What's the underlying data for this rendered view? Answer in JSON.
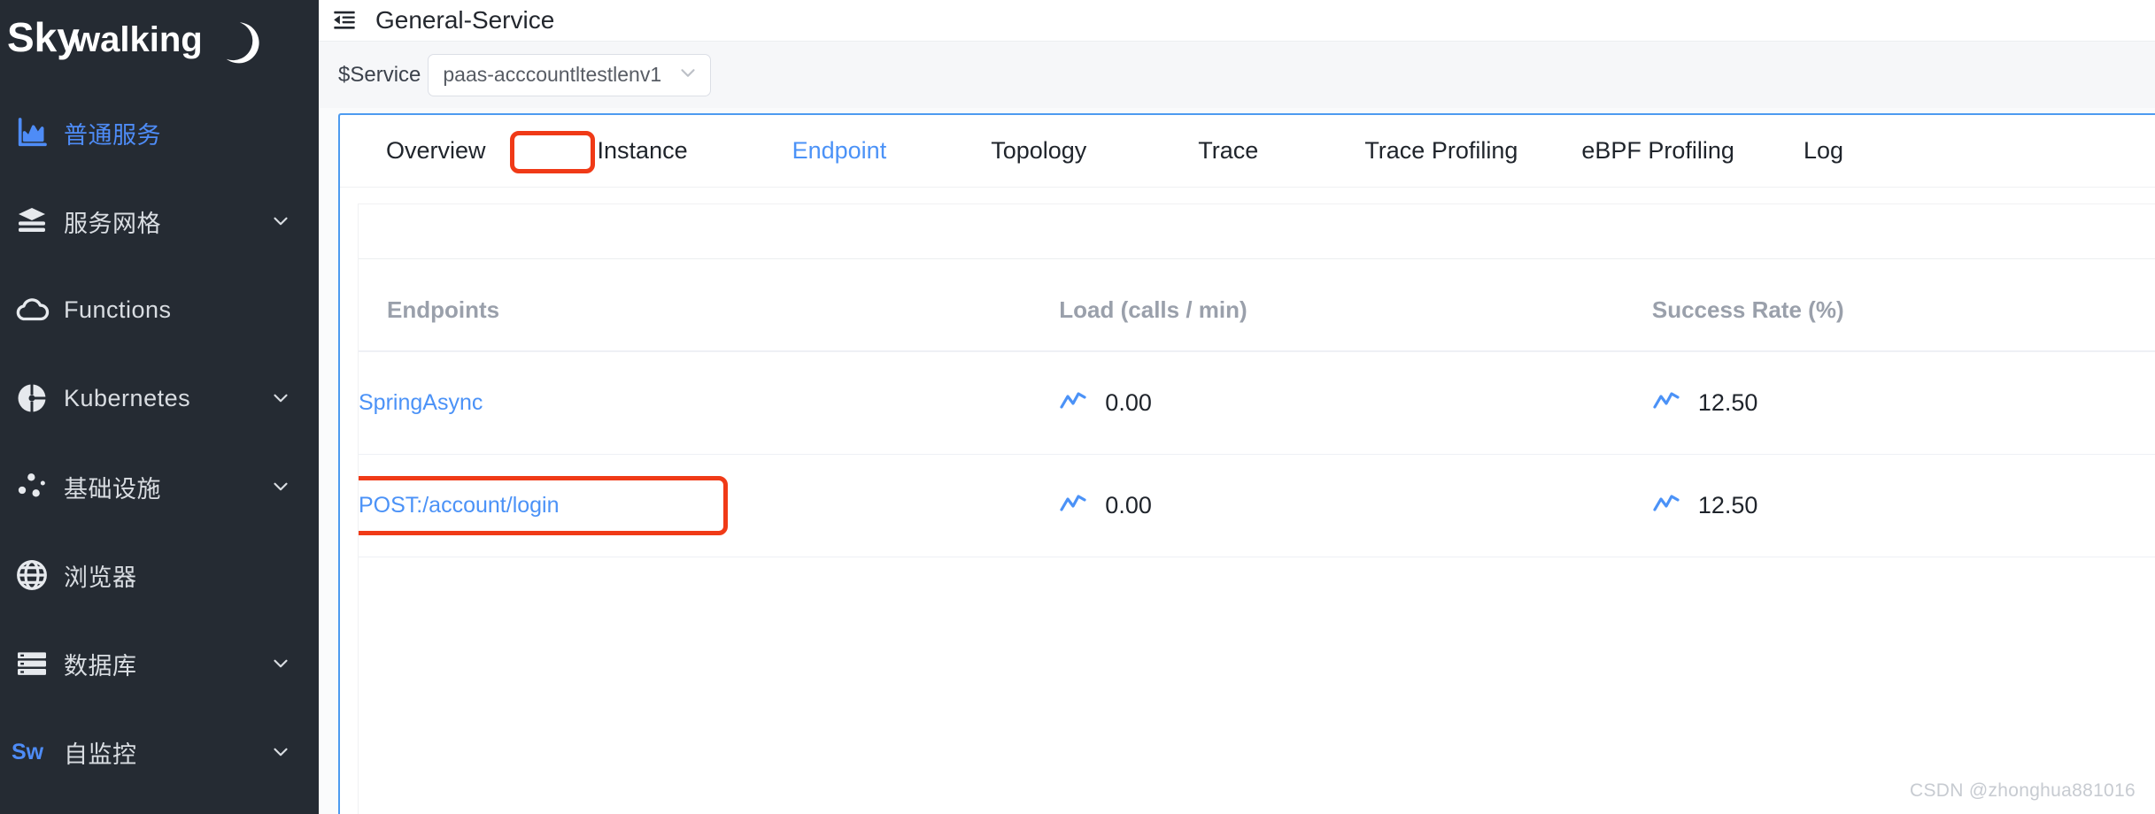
{
  "brand": {
    "name": "Skywalking",
    "logo_icon": "skywalking-moon-logo"
  },
  "sidebar": {
    "items": [
      {
        "label": "普通服务",
        "icon": "chart-bar-icon",
        "active": true,
        "has_chevron": false
      },
      {
        "label": "服务网格",
        "icon": "layers-stack-icon",
        "active": false,
        "has_chevron": true
      },
      {
        "label": "Functions",
        "icon": "cloud-icon",
        "active": false,
        "has_chevron": false
      },
      {
        "label": "Kubernetes",
        "icon": "pie-chart-icon",
        "active": false,
        "has_chevron": true
      },
      {
        "label": "基础设施",
        "icon": "dots-nodes-icon",
        "active": false,
        "has_chevron": true
      },
      {
        "label": "浏览器",
        "icon": "globe-icon",
        "active": false,
        "has_chevron": false
      },
      {
        "label": "数据库",
        "icon": "database-rows-icon",
        "active": false,
        "has_chevron": true
      },
      {
        "label": "自监控",
        "icon": "sw-logo-icon",
        "active": false,
        "has_chevron": true
      }
    ]
  },
  "topbar": {
    "fold_icon": "menu-fold-icon",
    "title": "General-Service"
  },
  "condition": {
    "label": "$Service",
    "selected": "paas-acccountltestlenv1",
    "chevron_icon": "chevron-down-icon"
  },
  "tabs": [
    {
      "label": "Overview",
      "active": false
    },
    {
      "label": "Instance",
      "active": false
    },
    {
      "label": "Endpoint",
      "active": true
    },
    {
      "label": "Topology",
      "active": false
    },
    {
      "label": "Trace",
      "active": false
    },
    {
      "label": "Trace Profiling",
      "active": false
    },
    {
      "label": "eBPF Profiling",
      "active": false
    },
    {
      "label": "Log",
      "active": false
    }
  ],
  "table": {
    "columns": [
      "Endpoints",
      "Load (calls / min)",
      "Success Rate (%)"
    ],
    "rows": [
      {
        "endpoint": "SpringAsync",
        "load": "0.00",
        "success_rate": "12.50",
        "highlighted": false
      },
      {
        "endpoint": "POST:/account/login",
        "load": "0.00",
        "success_rate": "12.50",
        "highlighted": true
      }
    ],
    "sparkline_icon": "line-chart-sparkline-icon"
  },
  "annotations": {
    "color": "#f03a17",
    "targets": [
      "tab-endpoint",
      "endpoint-post-account-login"
    ]
  },
  "watermark": "CSDN @zhonghua881016",
  "colors": {
    "sidebar_bg": "#252b33",
    "accent_blue": "#4b92f7",
    "panel_border_blue": "#4d9bf0",
    "annotation_red": "#f03a17",
    "header_text": "#9aa0ab"
  }
}
